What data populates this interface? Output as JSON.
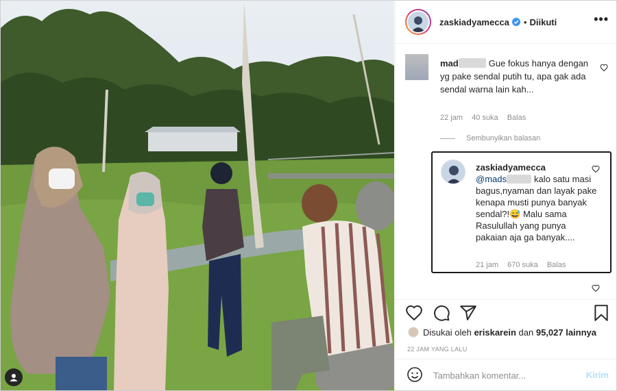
{
  "post": {
    "username": "zaskiadyamecca",
    "separator": "•",
    "follow_status": "Diikuti",
    "more_label": "•••"
  },
  "comments": [
    {
      "user": "mad",
      "text_line1": "Gue fokus hanya",
      "text_rest": "dengan yg pake sendal putih tu, apa gak ada sendal warna lain kah...",
      "age": "22 jam",
      "likes": "40 suka",
      "reply_label": "Balas"
    }
  ],
  "hide_replies": "Sembunyikan balasan",
  "reply": {
    "user": "zaskiadyamecca",
    "mention": "@mads",
    "text": "kalo satu masi bagus,nyaman dan layak pake kenapa musti punya banyak sendal?!",
    "emoji": "😅",
    "text2": "Malu sama Rasulullah yang punya pakaian aja ga banyak....",
    "age": "21 jam",
    "likes": "670 suka",
    "reply_label": "Balas"
  },
  "liked_by": {
    "prefix": "Disukai oleh",
    "user": "eriskarein",
    "conj": "dan",
    "count": "95,027 lainnya"
  },
  "timestamp": "22 JAM YANG LALU",
  "add_comment": {
    "placeholder": "Tambahkan komentar...",
    "post_label": "Kirim"
  },
  "icons": [
    "heart-icon",
    "comment-icon",
    "share-icon",
    "bookmark-icon",
    "emoji-icon",
    "verified-icon",
    "user-tag-icon"
  ],
  "colors": {
    "accent": "#0095f6",
    "verified": "#3897f0",
    "muted": "#8e8e8e",
    "post_disabled": "#b2dffc"
  }
}
